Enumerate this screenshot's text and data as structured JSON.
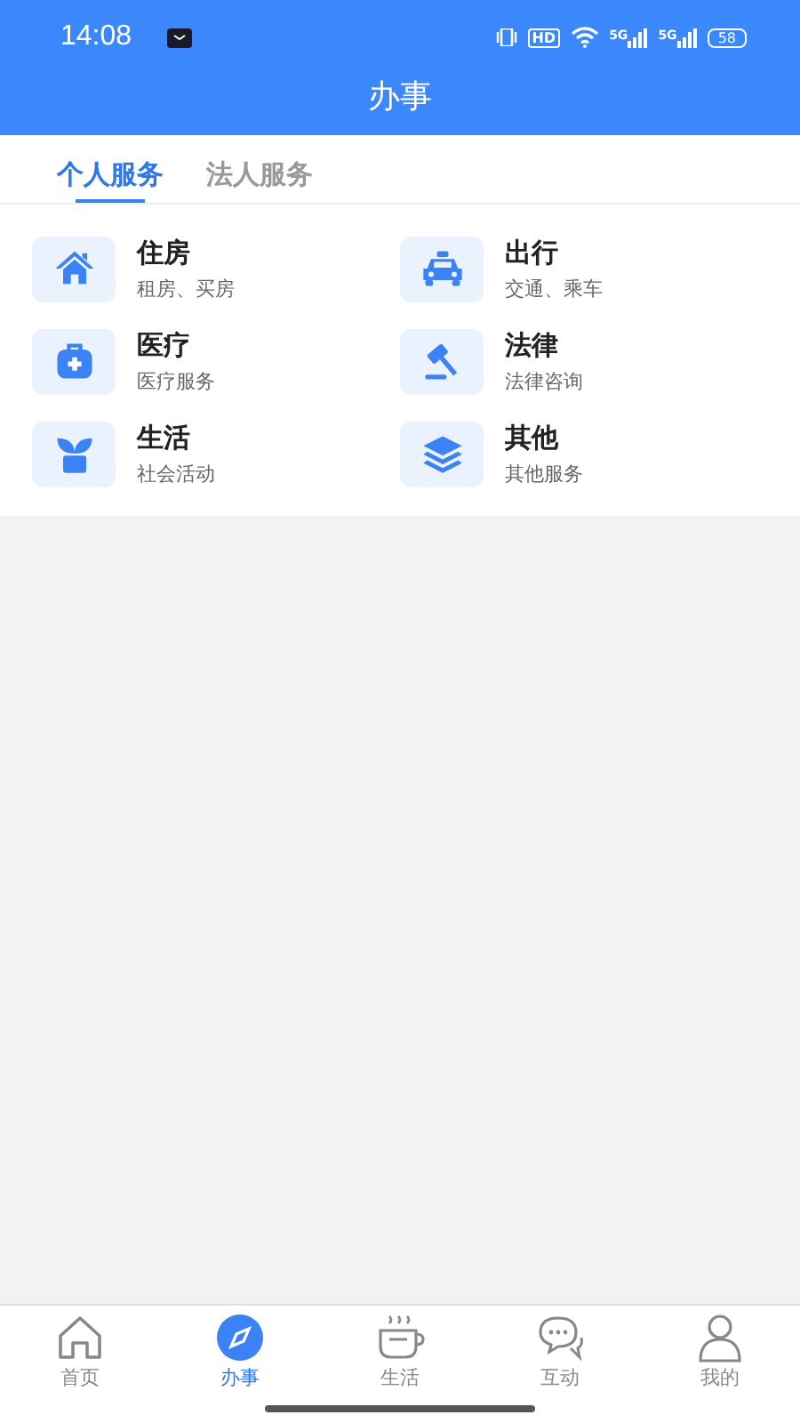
{
  "status_bar": {
    "time": "14:08",
    "hd": "HD",
    "signal_labels": [
      "5G",
      "5G"
    ],
    "battery": "58"
  },
  "header": {
    "title": "办事"
  },
  "tabs": [
    {
      "label": "个人服务",
      "selected": true
    },
    {
      "label": "法人服务",
      "selected": false
    }
  ],
  "services": [
    {
      "title": "住房",
      "subtitle": "租房、买房"
    },
    {
      "title": "出行",
      "subtitle": "交通、乘车"
    },
    {
      "title": "医疗",
      "subtitle": "医疗服务"
    },
    {
      "title": "法律",
      "subtitle": "法律咨询"
    },
    {
      "title": "生活",
      "subtitle": "社会活动"
    },
    {
      "title": "其他",
      "subtitle": "其他服务"
    }
  ],
  "bottom_nav": [
    {
      "label": "首页",
      "selected": false
    },
    {
      "label": "办事",
      "selected": true
    },
    {
      "label": "生活",
      "selected": false
    },
    {
      "label": "互动",
      "selected": false
    },
    {
      "label": "我的",
      "selected": false
    }
  ]
}
